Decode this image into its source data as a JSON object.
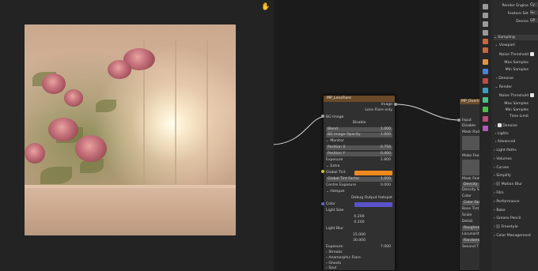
{
  "viewer": {
    "hand_icon": "hand-icon"
  },
  "node_lens": {
    "title": "MP_LensFlare",
    "image_label": "Image",
    "lens_flare_only": "Lens Flare only",
    "bg_image": "BG Image",
    "disable": "Disable",
    "blend_label": "Blend",
    "blend_value": "1.000",
    "bg_opacity_label": "BG Image Opacity",
    "bg_opacity_value": "1.000",
    "monitor": "Monitor",
    "pos_x_label": "Position X",
    "pos_x_value": "0.756",
    "pos_y_label": "Position Y",
    "pos_y_value": "0.400",
    "exposure_label": "Exposure",
    "exposure_value": "2.800",
    "extra": "Extra",
    "global_tint": "Global Tint",
    "tint_color": "#f08a1e",
    "global_tint_factor_label": "Global Tint Factor",
    "global_tint_factor_value": "1.000",
    "centre_exposure_label": "Centre Exposure",
    "centre_exposure_value": "0.000",
    "hotspot": "Hotspot",
    "debug_output": "Debug Output Hotspot",
    "color_label": "Color",
    "hotspot_color": "#5a52c8",
    "light_size": "Light Size",
    "ls1": "0.200",
    "ls2": "0.200",
    "light_blur": "Light Blur",
    "lb1": "15.000",
    "lb2": "30.000",
    "exposure2_label": "Exposure",
    "exposure2_value": "7.000",
    "streaks": "Streaks",
    "anamorphic": "Anamorphic Flare",
    "ghosts": "Ghosts",
    "soul": "Soul"
  },
  "node_overlay": {
    "title": "MP_Overla",
    "input": "Input",
    "disable": "Disable",
    "mask_radius": "Mask Radius",
    "make_feather": "Make Feather",
    "mask_feather": "Mask Feather",
    "density": "Density",
    "density_scale": "Density Sca",
    "color": "Color",
    "color_factor": "Color Fac",
    "base_tint": "Base Tint",
    "scale": "Scale",
    "detail": "Detail",
    "roughness": "Roughness",
    "lacunarity": "Lacunarity",
    "randomness": "Randomne",
    "second_t": "Second T"
  },
  "props": {
    "render_engine_label": "Render Engine",
    "render_engine_value": "Cy",
    "feature_set_label": "Feature Set",
    "feature_set_value": "Su",
    "device_label": "Device",
    "device_value": "GP",
    "sampling": "Sampling",
    "viewport": "Viewport",
    "noise_threshold": "Noise Threshold",
    "max_samples": "Max Samples",
    "min_samples": "Min Samples",
    "denoise": "Denoise",
    "render": "Render",
    "noise_threshold2": "Noise Threshold",
    "max_samples2": "Max Samples",
    "min_samples2": "Min Samples",
    "time_limit": "Time Limit",
    "denoise2": "Denoise",
    "lights": "Lights",
    "advanced": "Advanced",
    "light_paths": "Light Paths",
    "volumes": "Volumes",
    "curves": "Curves",
    "simplify": "Simplify",
    "motion_blur": "Motion Blur",
    "film": "Film",
    "performance": "Performance",
    "bake": "Bake",
    "grease_pencil": "Grease Pencil",
    "freestyle": "Freestyle",
    "color_management": "Color Management"
  }
}
